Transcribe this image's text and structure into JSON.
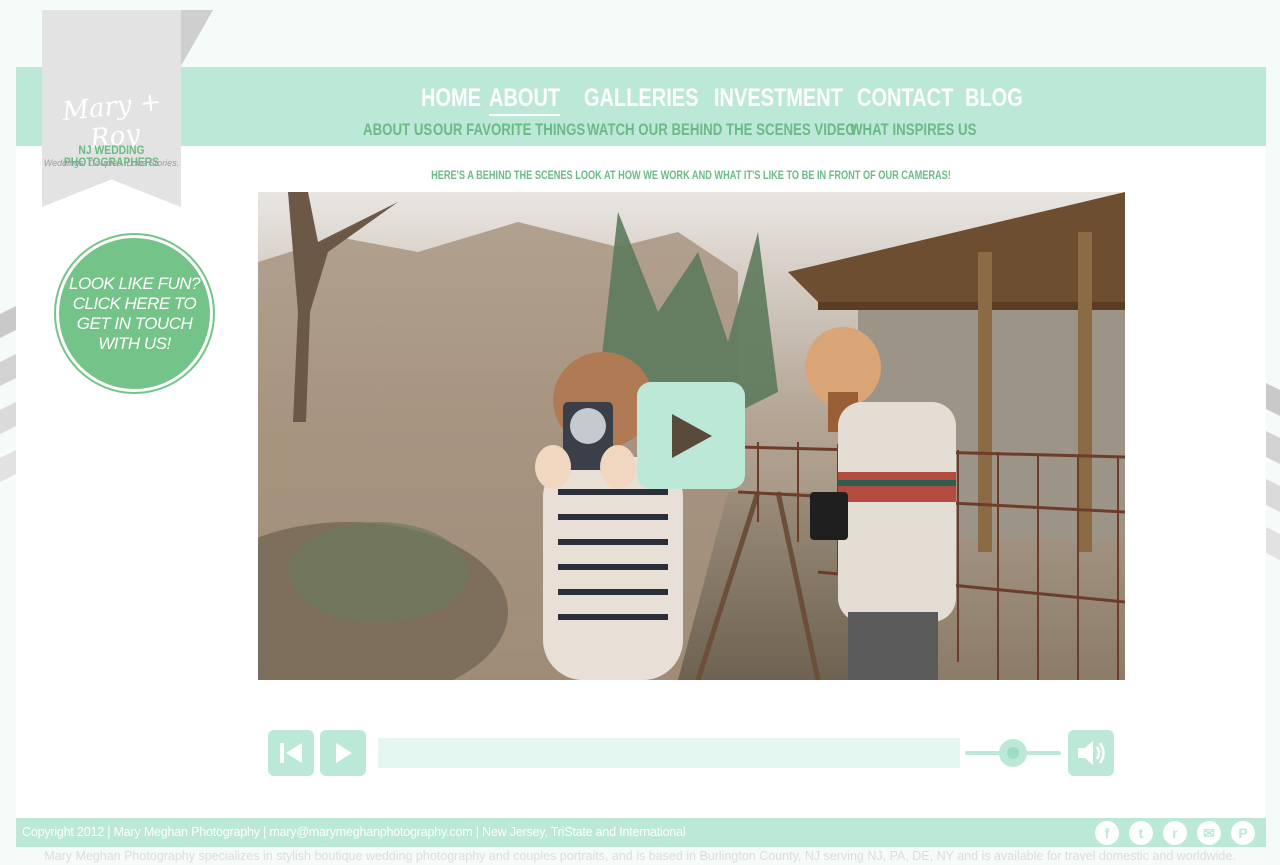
{
  "colors": {
    "mint": "#bce8d8",
    "green": "#74c388",
    "label_green": "#6dba86"
  },
  "logo": {
    "script": "Mary + Roy",
    "tagline": "NJ WEDDING PHOTOGRAPHERS",
    "subtagline": "Weddings. Couples. Love Stories."
  },
  "nav": {
    "main": [
      {
        "label": "HOME"
      },
      {
        "label": "ABOUT",
        "active": true
      },
      {
        "label": "GALLERIES"
      },
      {
        "label": "INVESTMENT"
      },
      {
        "label": "CONTACT"
      },
      {
        "label": "BLOG"
      }
    ],
    "sub": [
      {
        "label": "ABOUT US"
      },
      {
        "label": "OUR FAVORITE THINGS"
      },
      {
        "label": "WATCH OUR BEHIND THE SCENES VIDEO"
      },
      {
        "label": "WHAT INSPIRES US"
      }
    ]
  },
  "cta": {
    "text": "LOOK LIKE FUN? CLICK HERE TO GET IN TOUCH WITH US!"
  },
  "video": {
    "caption": "HERE'S A BEHIND THE SCENES LOOK AT HOW WE WORK AND WHAT IT'S LIKE TO BE IN FRONT OF OUR CAMERAS!",
    "progress": 0,
    "volume": 0.5,
    "controls": {
      "rewind_icon": "skip-back-icon",
      "play_icon": "play-icon",
      "volume_icon": "speaker-icon"
    }
  },
  "footer": {
    "copyright": "Copyright 2012 | Mary Meghan Photography | mary@marymeghanphotography.com | New Jersey, TriState and International",
    "description": "Mary Meghan Photography specializes in stylish boutique wedding photography and couples portraits, and is based in Burlington County, NJ serving NJ, PA, DE, NY and is available for travel domestic and worldwide.",
    "social": [
      "facebook-icon",
      "twitter-icon",
      "rss-icon",
      "email-icon",
      "pinterest-icon"
    ],
    "social_glyphs": [
      "f",
      "t",
      "r",
      "✉",
      "P"
    ]
  }
}
